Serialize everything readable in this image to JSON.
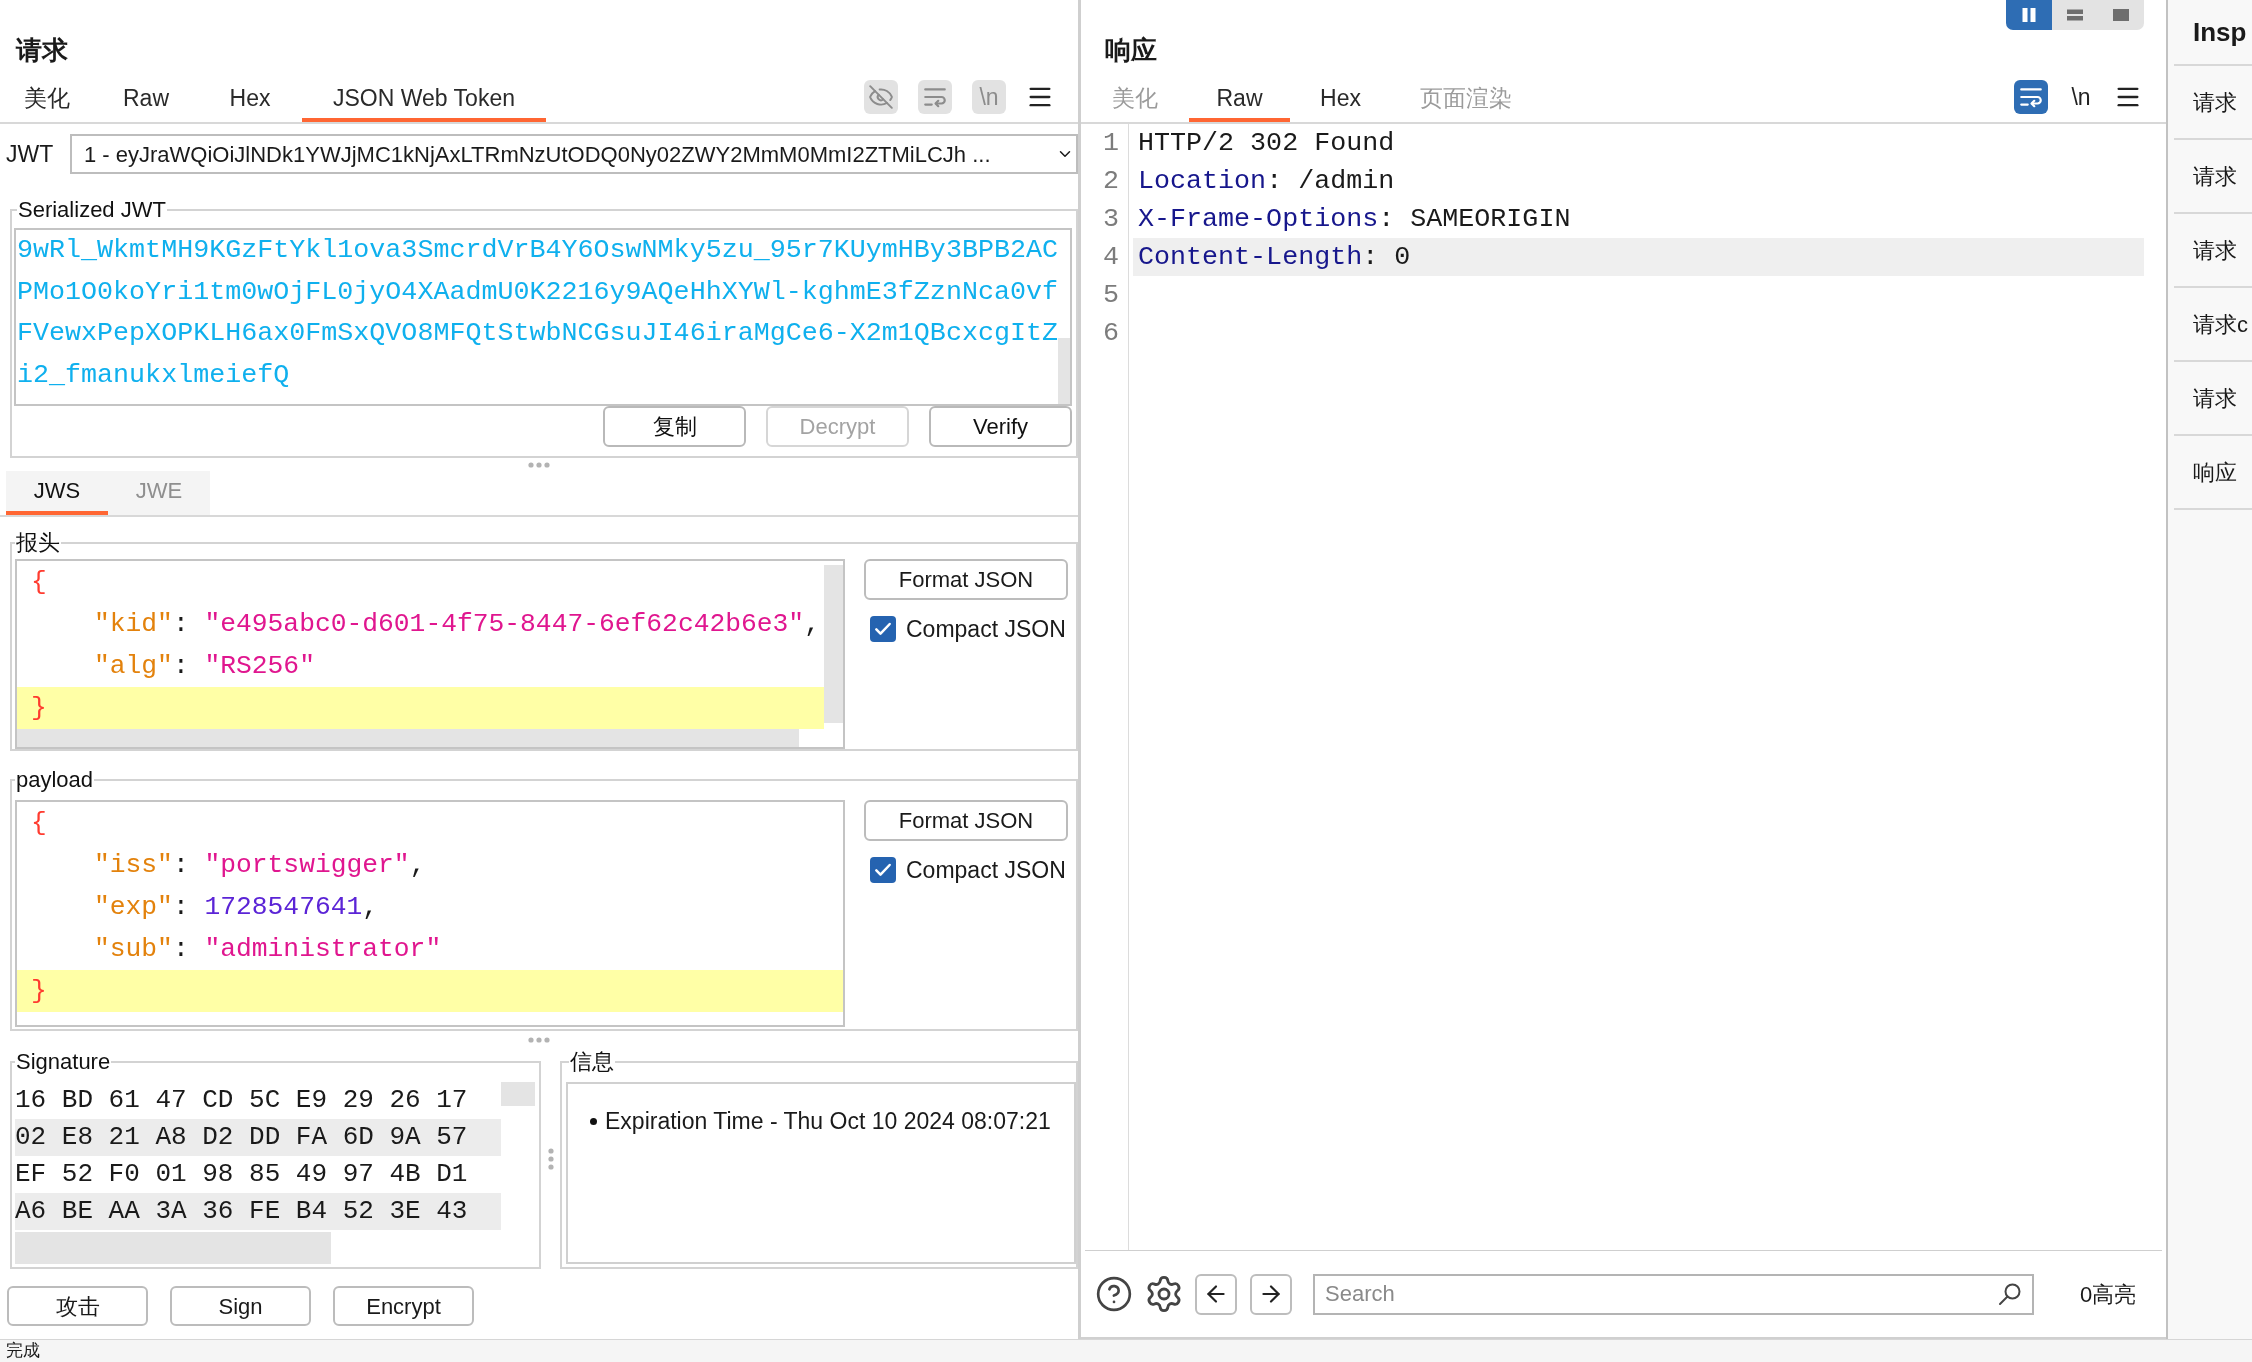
{
  "request": {
    "title": "请求",
    "tabs": [
      {
        "label": "美化",
        "selected": false,
        "disabled": false
      },
      {
        "label": "Raw",
        "selected": false,
        "disabled": false
      },
      {
        "label": "Hex",
        "selected": false,
        "disabled": false
      },
      {
        "label": "JSON Web Token",
        "selected": true,
        "disabled": false
      }
    ],
    "toolbar": [
      {
        "kind": "visibility",
        "disabled": true
      },
      {
        "kind": "wrap",
        "disabled": true
      },
      {
        "kind": "newline",
        "label": "\\n",
        "disabled": true
      },
      {
        "kind": "menu"
      }
    ]
  },
  "jwt": {
    "label": "JWT",
    "value": "1 - eyJraWQiOiJlNDk1YWJjMC1kNjAxLTRmNzUtODQ0Ny02ZWY2MmM0MmI2ZTMiLCJh ..."
  },
  "serialized": {
    "legend": "Serialized JWT",
    "lines": [
      "9wRl_WkmtMH9KGzFtYkl1ova3SmcrdVrB4Y6OswNMky5zu_95r7KUymHBy3BPB2AC",
      "PMo1O0koYri1tm0wOjFL0jyO4XAadmU0K2216y9AQeHhXYWl-kghmE3fZznNca0vf",
      "FVewxPepXOPKLH6ax0FmSxQVO8MFQtStwbNCGsuJI46iraMgCe6-X2m1QBcxcgItZ",
      "i2_fmanukxlmeiefQ"
    ],
    "buttons": [
      {
        "label": "复制",
        "disabled": false
      },
      {
        "label": "Decrypt",
        "disabled": true
      },
      {
        "label": "Verify",
        "disabled": false
      }
    ]
  },
  "jws_tabs": [
    {
      "label": "JWS",
      "selected": true
    },
    {
      "label": "JWE",
      "selected": false
    }
  ],
  "header": {
    "legend": "报头",
    "open": "{",
    "members": [
      [
        {
          "kind": "key",
          "text": "\"kid\""
        },
        {
          "kind": "punct",
          "text": ": "
        },
        {
          "kind": "string",
          "text": "\"e495abc0-d601-4f75-8447-6ef62c42b6e3\""
        },
        {
          "kind": "punct",
          "text": ","
        }
      ],
      [
        {
          "kind": "key",
          "text": "\"alg\""
        },
        {
          "kind": "punct",
          "text": ": "
        },
        {
          "kind": "string",
          "text": "\"RS256\""
        }
      ]
    ],
    "close": "}",
    "close_highlighted": true,
    "format_button": "Format JSON",
    "compact": {
      "label": "Compact JSON",
      "checked": true
    }
  },
  "payload": {
    "legend": "payload",
    "open": "{",
    "members": [
      [
        {
          "kind": "key",
          "text": "\"iss\""
        },
        {
          "kind": "punct",
          "text": ": "
        },
        {
          "kind": "string",
          "text": "\"portswigger\""
        },
        {
          "kind": "punct",
          "text": ","
        }
      ],
      [
        {
          "kind": "key",
          "text": "\"exp\""
        },
        {
          "kind": "punct",
          "text": ": "
        },
        {
          "kind": "number",
          "text": "1728547641"
        },
        {
          "kind": "punct",
          "text": ","
        }
      ],
      [
        {
          "kind": "key",
          "text": "\"sub\""
        },
        {
          "kind": "punct",
          "text": ": "
        },
        {
          "kind": "string",
          "text": "\"administrator\""
        }
      ]
    ],
    "close": "}",
    "close_highlighted": true,
    "format_button": "Format JSON",
    "compact": {
      "label": "Compact JSON",
      "checked": true
    }
  },
  "signature": {
    "legend": "Signature",
    "rows": [
      "16 BD 61 47 CD 5C E9 29 26 17",
      "02 E8 21 A8 D2 DD FA 6D 9A 57",
      "EF 52 F0 01 98 85 49 97 4B D1",
      "A6 BE AA 3A 36 FE B4 52 3E 43"
    ]
  },
  "info": {
    "legend": "信息",
    "items": [
      "Expiration Time - Thu Oct 10 2024 08:07:21"
    ]
  },
  "actions": [
    "攻击",
    "Sign",
    "Encrypt"
  ],
  "response": {
    "title": "响应",
    "view_modes": [
      {
        "kind": "columns",
        "selected": true
      },
      {
        "kind": "rows",
        "selected": false
      },
      {
        "kind": "single",
        "selected": false
      }
    ],
    "tabs": [
      {
        "label": "美化",
        "selected": false,
        "disabled": true
      },
      {
        "label": "Raw",
        "selected": true,
        "disabled": false
      },
      {
        "label": "Hex",
        "selected": false,
        "disabled": false
      },
      {
        "label": "页面渲染",
        "selected": false,
        "disabled": true
      }
    ],
    "toolbar": [
      {
        "kind": "wrap",
        "on": true,
        "disabled": false
      },
      {
        "kind": "newline",
        "label": "\\n",
        "on": false,
        "disabled": false
      },
      {
        "kind": "menu"
      }
    ],
    "lines": [
      {
        "number": "1",
        "tokens": [
          {
            "kind": "text",
            "text": "HTTP/2 302 Found"
          }
        ],
        "highlighted": false
      },
      {
        "number": "2",
        "tokens": [
          {
            "kind": "name",
            "text": "Location"
          },
          {
            "kind": "text",
            "text": ": /admin"
          }
        ],
        "highlighted": false
      },
      {
        "number": "3",
        "tokens": [
          {
            "kind": "name",
            "text": "X-Frame-Options"
          },
          {
            "kind": "text",
            "text": ": SAMEORIGIN"
          }
        ],
        "highlighted": false
      },
      {
        "number": "4",
        "tokens": [
          {
            "kind": "name",
            "text": "Content-Length"
          },
          {
            "kind": "text",
            "text": ": 0"
          }
        ],
        "highlighted": true
      },
      {
        "number": "5",
        "highlighted": false
      },
      {
        "number": "6",
        "highlighted": false
      }
    ]
  },
  "search": {
    "placeholder": "Search",
    "highlight_count": "0高亮"
  },
  "inspector": {
    "title": "Insp",
    "items": [
      "请求",
      "请求",
      "请求",
      "请求c",
      "请求",
      "响应"
    ]
  },
  "status_bar": "完成"
}
